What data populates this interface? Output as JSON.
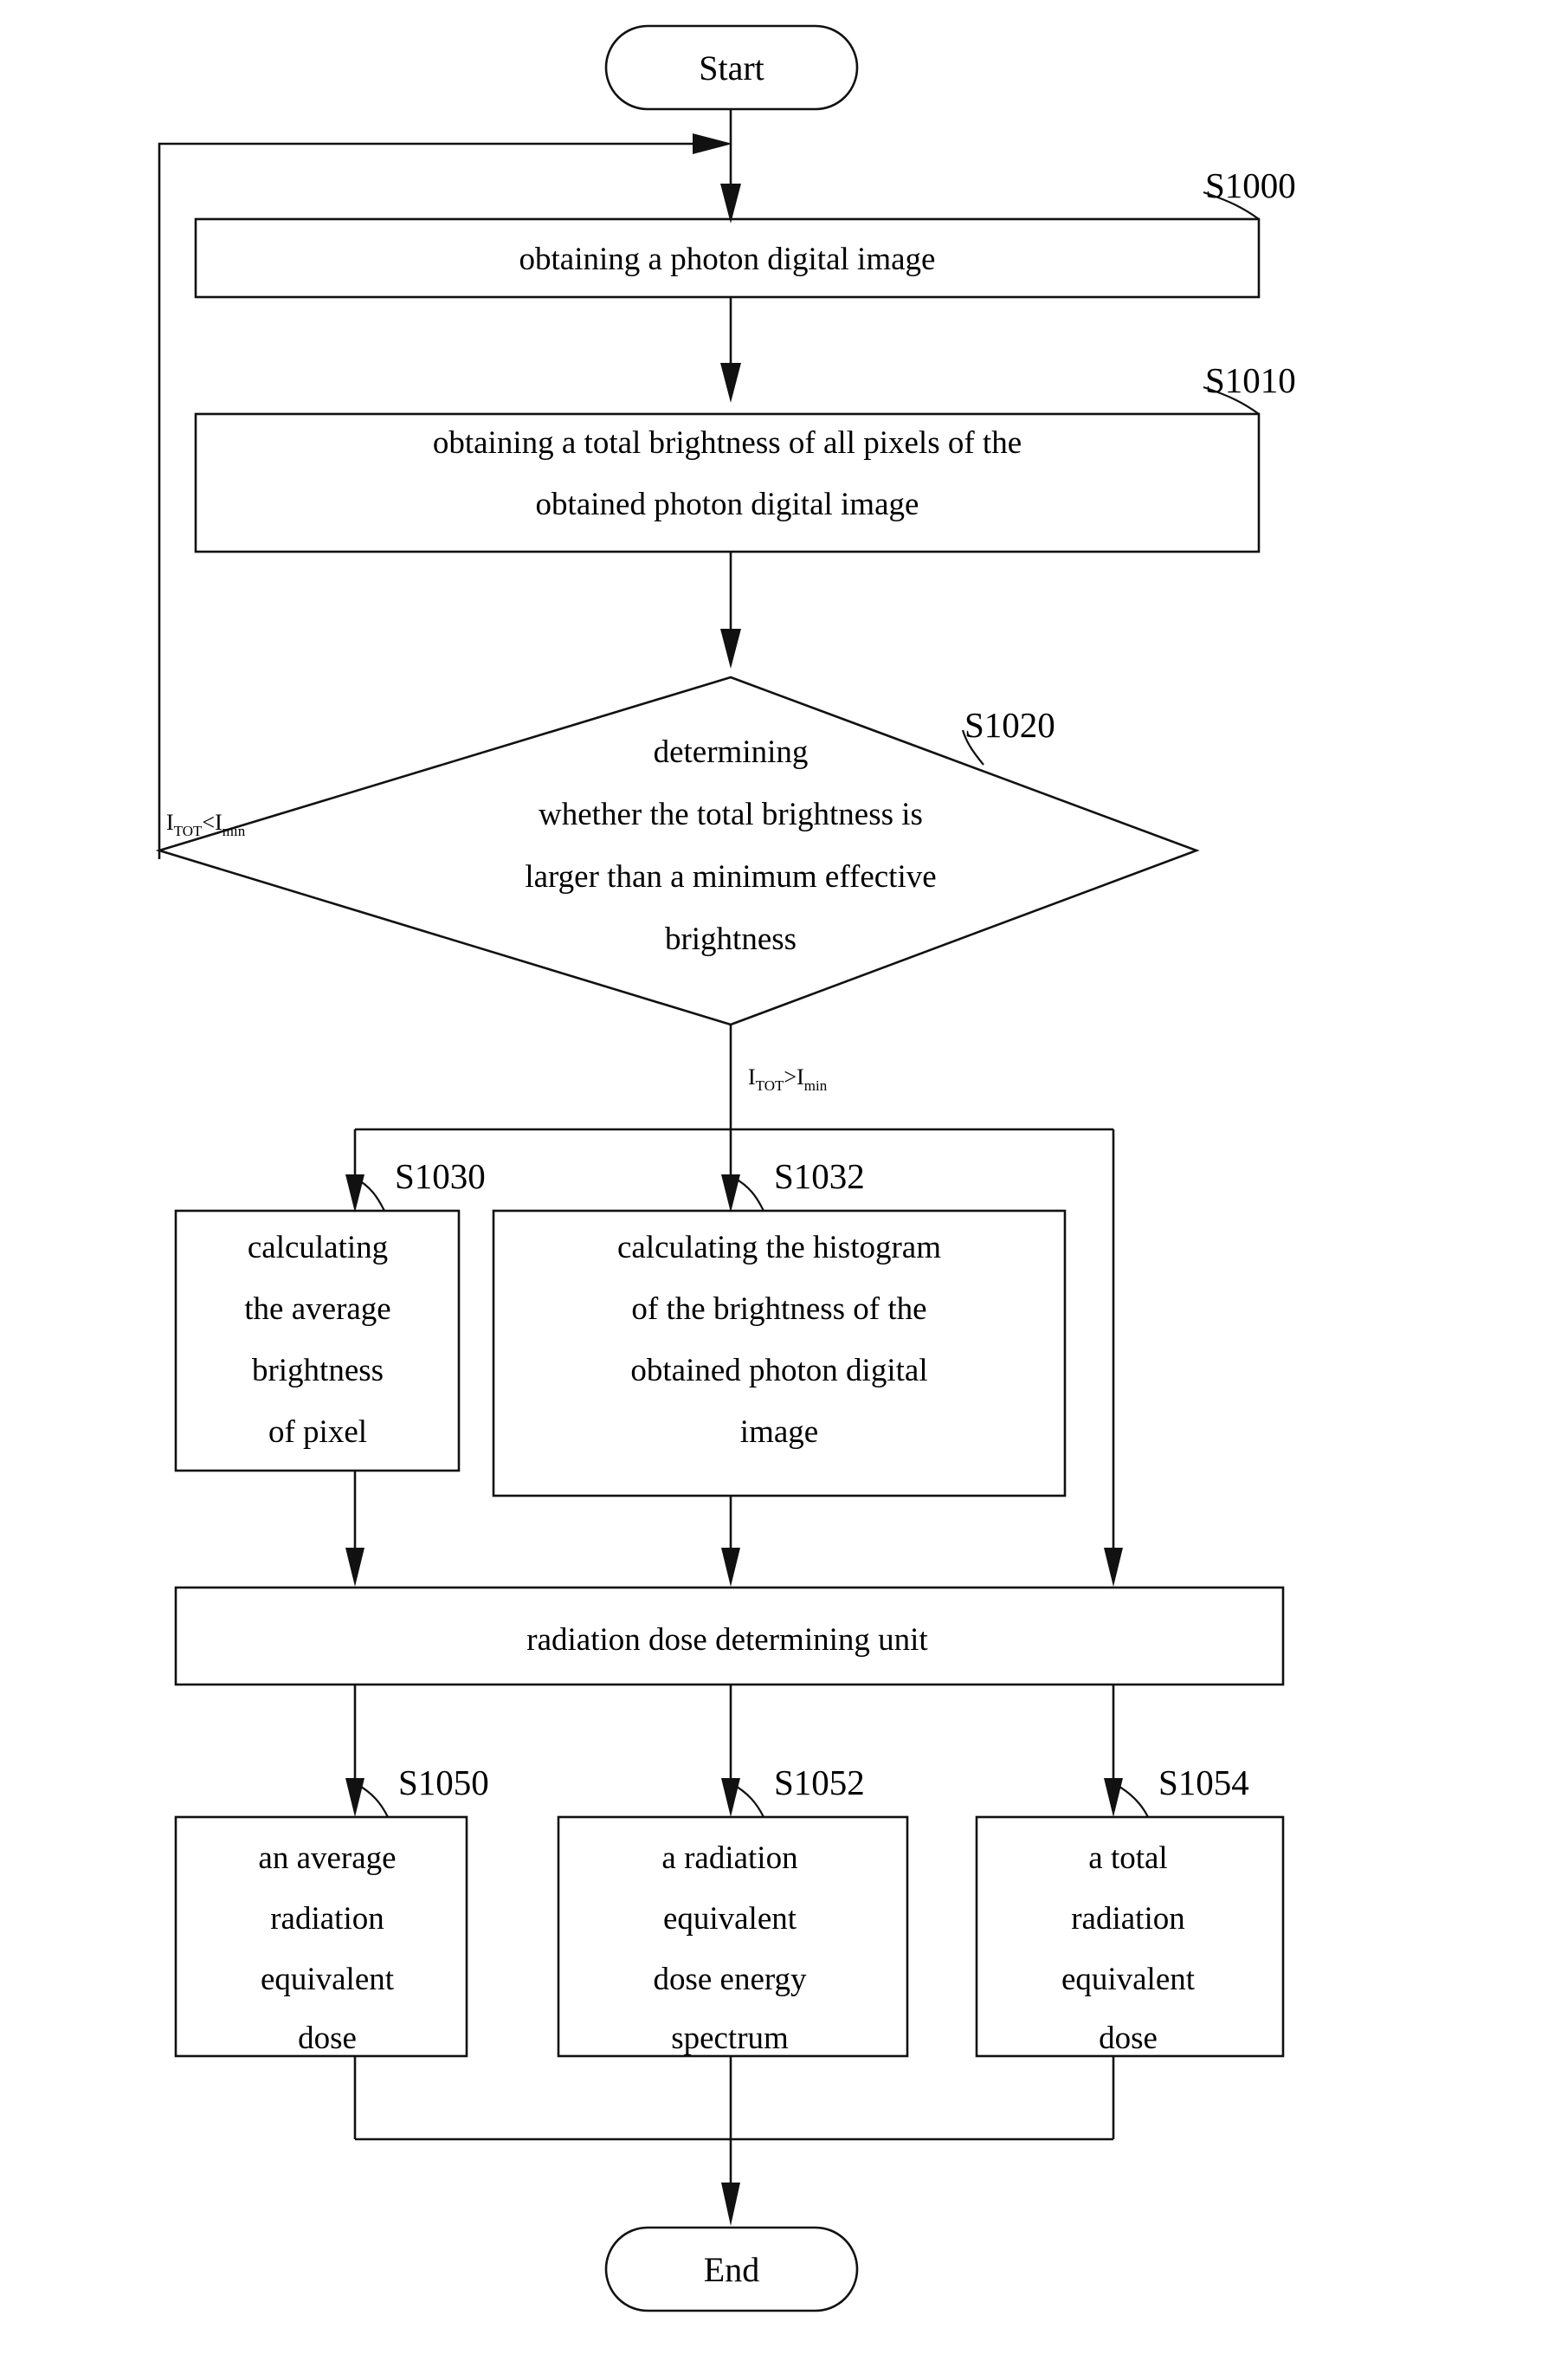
{
  "diagram": {
    "type": "flowchart",
    "title_visible": false,
    "line_color": "#111111",
    "background": "#ffffff",
    "terminators": {
      "start": "Start",
      "end": "End"
    },
    "nodes": [
      {
        "id": "start",
        "kind": "terminator",
        "label": "Start",
        "ref": ""
      },
      {
        "id": "s1000",
        "kind": "process",
        "label": "obtaining a photon digital image",
        "lines": [
          "obtaining a photon digital image"
        ],
        "ref": "S1000"
      },
      {
        "id": "s1010",
        "kind": "process",
        "label": "obtaining a total brightness of all pixels of the obtained photon digital image",
        "lines": [
          "obtaining a total brightness of all pixels of the",
          "obtained photon digital image"
        ],
        "ref": "S1010"
      },
      {
        "id": "s1020",
        "kind": "decision",
        "label": "determining whether the total brightness is larger than a minimum effective brightness",
        "lines": [
          "determining",
          "whether the total brightness is",
          "larger than a minimum effective",
          "brightness"
        ],
        "ref": "S1020"
      },
      {
        "id": "s1030",
        "kind": "process",
        "label": "calculating the average brightness of pixel",
        "lines": [
          "calculating",
          "the average",
          "brightness",
          "of pixel"
        ],
        "ref": "S1030"
      },
      {
        "id": "s1032",
        "kind": "process",
        "label": "calculating the histogram of the brightness of the obtained photon digital image",
        "lines": [
          "calculating the histogram",
          "of the brightness of the",
          "obtained photon digital",
          "image"
        ],
        "ref": "S1032"
      },
      {
        "id": "unit",
        "kind": "process",
        "label": "radiation dose determining unit",
        "lines": [
          "radiation dose determining unit"
        ],
        "ref": ""
      },
      {
        "id": "s1050",
        "kind": "process",
        "label": "an average radiation equivalent dose",
        "lines": [
          "an average",
          "radiation",
          "equivalent",
          "dose"
        ],
        "ref": "S1050"
      },
      {
        "id": "s1052",
        "kind": "process",
        "label": "a radiation equivalent dose energy spectrum",
        "lines": [
          "a radiation",
          "equivalent",
          "dose energy",
          "spectrum"
        ],
        "ref": "S1052"
      },
      {
        "id": "s1054",
        "kind": "process",
        "label": "a total radiation equivalent dose",
        "lines": [
          "a total",
          "radiation",
          "equivalent",
          "dose"
        ],
        "ref": "S1054"
      },
      {
        "id": "end",
        "kind": "terminator",
        "label": "End",
        "ref": ""
      }
    ],
    "reference_labels": [
      "S1000",
      "S1010",
      "S1020",
      "S1030",
      "S1032",
      "S1050",
      "S1052",
      "S1054"
    ],
    "edge_labels": {
      "no_branch": {
        "var": "I",
        "var_sub": "TOT",
        "op": "<",
        "limit": "I",
        "limit_sub": "min",
        "text": "ITOT<Imin"
      },
      "yes_branch": {
        "var": "I",
        "var_sub": "TOT",
        "op": ">",
        "limit": "I",
        "limit_sub": "min",
        "text": "ITOT>Imin"
      }
    }
  }
}
